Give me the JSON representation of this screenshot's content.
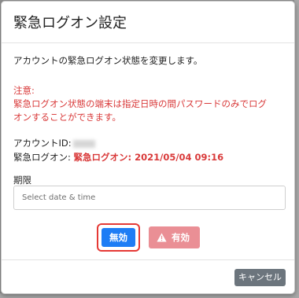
{
  "modal": {
    "title": "緊急ログオン設定"
  },
  "body": {
    "intro": "アカウントの緊急ログオン状態を変更します。",
    "notice_heading": "注意:",
    "notice_line1": "緊急ログオン状態の端末は指定日時の間パスワードのみでログ",
    "notice_line2": "オンすることができます。",
    "account_id_label": "アカウントID:",
    "status_label": "緊急ログオン:",
    "status_value": "緊急ログオン: 2021/05/04 09:16",
    "deadline_label": "期限",
    "date_placeholder": "Select date & time",
    "date_value": ""
  },
  "buttons": {
    "disable_label": "無効",
    "enable_label": "有効",
    "enable_icon": "warning-icon",
    "cancel_label": "キャンセル"
  },
  "colors": {
    "primary": "#1e7df5",
    "danger_text": "#d93a3a",
    "danger_button": "#ea8f95",
    "highlight_border": "#e53935",
    "secondary_button": "#6c757d"
  }
}
